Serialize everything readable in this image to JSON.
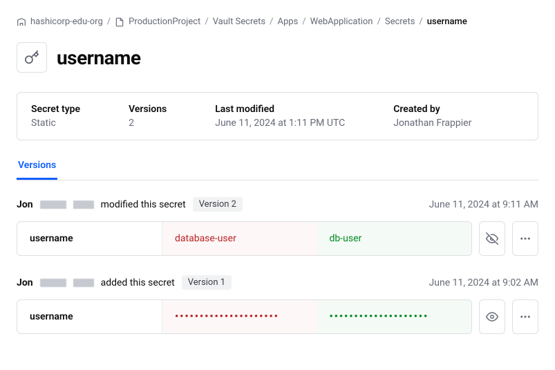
{
  "breadcrumb": {
    "org": "hashicorp-edu-org",
    "project": "ProductionProject",
    "vault": "Vault Secrets",
    "apps": "Apps",
    "app": "WebApplication",
    "secrets": "Secrets",
    "current": "username"
  },
  "page_title": "username",
  "meta": {
    "type_label": "Secret type",
    "type_value": "Static",
    "versions_label": "Versions",
    "versions_value": "2",
    "modified_label": "Last modified",
    "modified_value": "June 11, 2024 at 1:11 PM UTC",
    "created_label": "Created by",
    "created_value": "Jonathan Frappier"
  },
  "tabs": {
    "versions": "Versions"
  },
  "entries": [
    {
      "actor": "Jon",
      "action": "modified this secret",
      "version_label": "Version 2",
      "timestamp": "June 11, 2024 at 9:11 AM",
      "key": "username",
      "old_value": "database-user",
      "new_value": "db-user",
      "revealed": true
    },
    {
      "actor": "Jon",
      "action": "added this secret",
      "version_label": "Version 1",
      "timestamp": "June 11, 2024 at 9:02 AM",
      "key": "username",
      "old_value": "•••••••••••••••••••••",
      "new_value": "••••••••••••••••••••",
      "revealed": false
    }
  ]
}
